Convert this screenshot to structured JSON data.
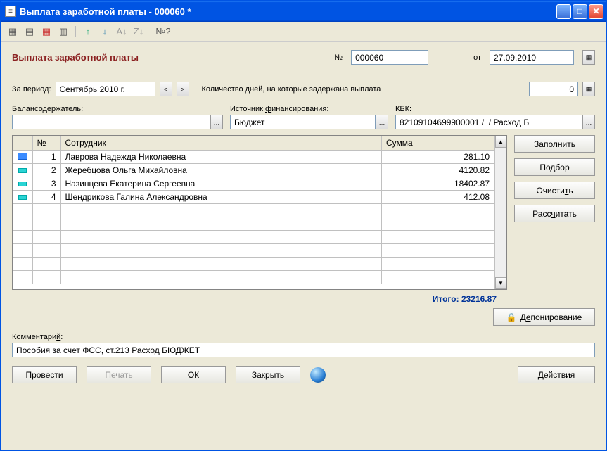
{
  "window": {
    "title": "Выплата заработной платы - 000060 *"
  },
  "doc": {
    "heading": "Выплата заработной платы",
    "num_label": "№",
    "number": "000060",
    "from_label": "от",
    "date": "27.09.2010"
  },
  "period": {
    "label": "За период:",
    "value": "Сентябрь 2010 г.",
    "days_label": "Количество дней, на которые задержана выплата",
    "days_value": "0"
  },
  "fields": {
    "balance_label": "Балансодержатель:",
    "balance_value": "",
    "source_label": "Источник финансирования:",
    "source_value": "Бюджет",
    "kbk_label": "КБК:",
    "kbk_value": "82109104699900001 /  / Расход Б"
  },
  "table": {
    "headers": {
      "num": "№",
      "employee": "Сотрудник",
      "amount": "Сумма"
    },
    "rows": [
      {
        "num": "1",
        "employee": "Лаврова Надежда Николаевна",
        "amount": "281.10"
      },
      {
        "num": "2",
        "employee": "Жеребцова Ольга Михайловна",
        "amount": "4120.82"
      },
      {
        "num": "3",
        "employee": "Назинцева Екатерина Сергеевна",
        "amount": "18402.87"
      },
      {
        "num": "4",
        "employee": "Шендрикова Галина Александровна",
        "amount": "412.08"
      }
    ]
  },
  "total": {
    "label": "Итого:",
    "value": "23216.87"
  },
  "side_buttons": {
    "fill": "Заполнить",
    "select": "Подбор",
    "clear": "Очистить",
    "calculate": "Рассчитать"
  },
  "deposit_button": "Депонирование",
  "comment": {
    "label": "Комментарий:",
    "value": "Пособия за счет ФСС, ст.213 Расход БЮДЖЕТ"
  },
  "footer": {
    "post": "Провести",
    "print": "Печать",
    "ok": "ОК",
    "close": "Закрыть",
    "actions": "Действия"
  }
}
